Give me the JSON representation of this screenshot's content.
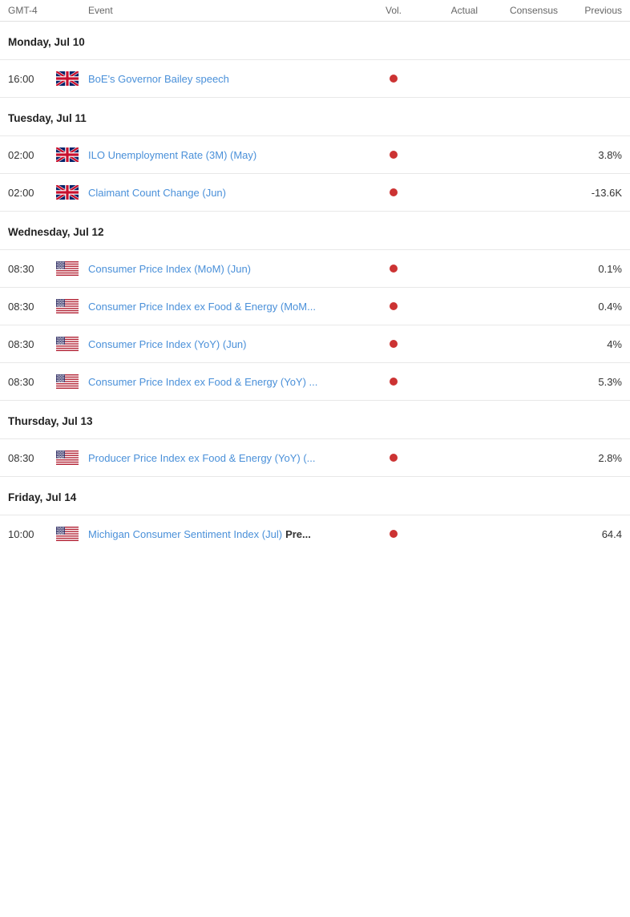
{
  "header": {
    "timezone": "GMT-4",
    "col_event": "Event",
    "col_vol": "Vol.",
    "col_actual": "Actual",
    "col_consensus": "Consensus",
    "col_previous": "Previous"
  },
  "days": [
    {
      "label": "Monday, Jul 10",
      "events": [
        {
          "time": "16:00",
          "flag": "uk",
          "event_link": "BoE's Governor Bailey speech",
          "event_bold": "",
          "vol_dot": true,
          "actual": "",
          "consensus": "",
          "previous": ""
        }
      ]
    },
    {
      "label": "Tuesday, Jul 11",
      "events": [
        {
          "time": "02:00",
          "flag": "uk",
          "event_link": "ILO Unemployment Rate (3M) (May)",
          "event_bold": "",
          "vol_dot": true,
          "actual": "",
          "consensus": "",
          "previous": "3.8%"
        },
        {
          "time": "02:00",
          "flag": "uk",
          "event_link": "Claimant Count Change (Jun)",
          "event_bold": "",
          "vol_dot": true,
          "actual": "",
          "consensus": "",
          "previous": "-13.6K"
        }
      ]
    },
    {
      "label": "Wednesday, Jul 12",
      "events": [
        {
          "time": "08:30",
          "flag": "us",
          "event_link": "Consumer Price Index (MoM) (Jun)",
          "event_bold": "",
          "vol_dot": true,
          "actual": "",
          "consensus": "",
          "previous": "0.1%"
        },
        {
          "time": "08:30",
          "flag": "us",
          "event_link": "Consumer Price Index ex Food & Energy (MoM...",
          "event_bold": "",
          "vol_dot": true,
          "actual": "",
          "consensus": "",
          "previous": "0.4%"
        },
        {
          "time": "08:30",
          "flag": "us",
          "event_link": "Consumer Price Index (YoY) (Jun)",
          "event_bold": "",
          "vol_dot": true,
          "actual": "",
          "consensus": "",
          "previous": "4%"
        },
        {
          "time": "08:30",
          "flag": "us",
          "event_link": "Consumer Price Index ex Food & Energy (YoY) ...",
          "event_bold": "",
          "vol_dot": true,
          "actual": "",
          "consensus": "",
          "previous": "5.3%"
        }
      ]
    },
    {
      "label": "Thursday, Jul 13",
      "events": [
        {
          "time": "08:30",
          "flag": "us",
          "event_link": "Producer Price Index ex Food & Energy (YoY) (...",
          "event_bold": "",
          "vol_dot": true,
          "actual": "",
          "consensus": "",
          "previous": "2.8%"
        }
      ]
    },
    {
      "label": "Friday, Jul 14",
      "events": [
        {
          "time": "10:00",
          "flag": "us",
          "event_link": "Michigan Consumer Sentiment Index (Jul)",
          "event_bold": "Pre...",
          "vol_dot": true,
          "actual": "",
          "consensus": "",
          "previous": "64.4"
        }
      ]
    }
  ]
}
